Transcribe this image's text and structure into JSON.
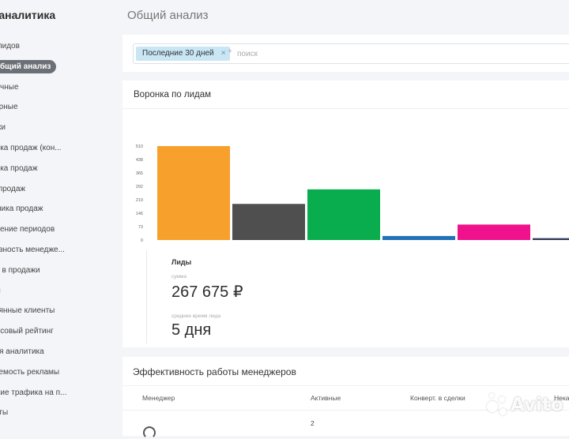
{
  "sidebar": {
    "brand": "M-аналитика",
    "items": [
      {
        "label": "лиз лидов"
      },
      {
        "label": "бщий анализ",
        "active": true
      },
      {
        "label": "ервичные"
      },
      {
        "label": "овторные"
      },
      {
        "label": "одажи"
      },
      {
        "label": "оронка продаж (кон..."
      },
      {
        "label": "оронка продаж"
      },
      {
        "label": "лан продаж"
      },
      {
        "label": "инамика продаж"
      },
      {
        "label": "равнение периодов"
      },
      {
        "label": "ективность менедже..."
      },
      {
        "label": "клад в продажи"
      },
      {
        "label": "енты"
      },
      {
        "label": "остоянные клиенты"
      },
      {
        "label": "инансовый рейтинг"
      },
      {
        "label": "озная аналитика"
      },
      {
        "label": "купаемость рекламы"
      },
      {
        "label": "лияние трафика на п..."
      },
      {
        "label": "отчеты"
      }
    ]
  },
  "page": {
    "title": "Общий анализ"
  },
  "filter": {
    "tag": "Последние 30 дней",
    "tag_close": "×",
    "search_plus": "+",
    "search_placeholder": "поиск"
  },
  "funnel": {
    "title": "Воронка по лидам",
    "stats": {
      "heading": "Лиды",
      "sum_label": "сумма",
      "sum_value": "267 675 ₽",
      "time_label": "среднее время лида",
      "time_value": "5 дня"
    }
  },
  "chart_data": {
    "type": "bar",
    "title": "Воронка по лидам",
    "yticks": [
      "510",
      "438",
      "365",
      "292",
      "219",
      "146",
      "73",
      "0"
    ],
    "ylim": [
      0,
      510
    ],
    "values": [
      510,
      196,
      275,
      22,
      84,
      10
    ],
    "colors": [
      "#f7a02c",
      "#4f4f4f",
      "#0aad4e",
      "#2272b8",
      "#f0128c",
      "#333a5a"
    ],
    "grid": false
  },
  "managers": {
    "title": "Эффективность работы менеджеров",
    "columns": [
      "Менеджер",
      "Активные",
      "Конверт. в сделки",
      "Нека"
    ],
    "rows": [
      {
        "active": "2"
      }
    ]
  },
  "watermark": {
    "text": "Avito"
  }
}
